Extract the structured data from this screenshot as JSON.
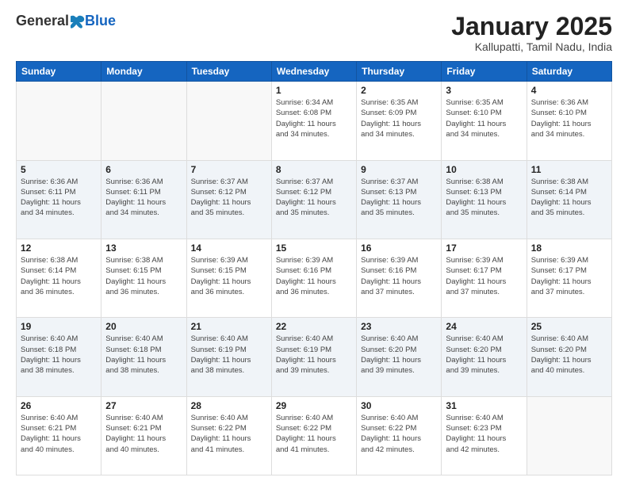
{
  "header": {
    "logo_general": "General",
    "logo_blue": "Blue",
    "month_title": "January 2025",
    "location": "Kallupatti, Tamil Nadu, India"
  },
  "days_of_week": [
    "Sunday",
    "Monday",
    "Tuesday",
    "Wednesday",
    "Thursday",
    "Friday",
    "Saturday"
  ],
  "weeks": [
    {
      "shaded": false,
      "days": [
        {
          "num": "",
          "info": ""
        },
        {
          "num": "",
          "info": ""
        },
        {
          "num": "",
          "info": ""
        },
        {
          "num": "1",
          "info": "Sunrise: 6:34 AM\nSunset: 6:08 PM\nDaylight: 11 hours\nand 34 minutes."
        },
        {
          "num": "2",
          "info": "Sunrise: 6:35 AM\nSunset: 6:09 PM\nDaylight: 11 hours\nand 34 minutes."
        },
        {
          "num": "3",
          "info": "Sunrise: 6:35 AM\nSunset: 6:10 PM\nDaylight: 11 hours\nand 34 minutes."
        },
        {
          "num": "4",
          "info": "Sunrise: 6:36 AM\nSunset: 6:10 PM\nDaylight: 11 hours\nand 34 minutes."
        }
      ]
    },
    {
      "shaded": true,
      "days": [
        {
          "num": "5",
          "info": "Sunrise: 6:36 AM\nSunset: 6:11 PM\nDaylight: 11 hours\nand 34 minutes."
        },
        {
          "num": "6",
          "info": "Sunrise: 6:36 AM\nSunset: 6:11 PM\nDaylight: 11 hours\nand 34 minutes."
        },
        {
          "num": "7",
          "info": "Sunrise: 6:37 AM\nSunset: 6:12 PM\nDaylight: 11 hours\nand 35 minutes."
        },
        {
          "num": "8",
          "info": "Sunrise: 6:37 AM\nSunset: 6:12 PM\nDaylight: 11 hours\nand 35 minutes."
        },
        {
          "num": "9",
          "info": "Sunrise: 6:37 AM\nSunset: 6:13 PM\nDaylight: 11 hours\nand 35 minutes."
        },
        {
          "num": "10",
          "info": "Sunrise: 6:38 AM\nSunset: 6:13 PM\nDaylight: 11 hours\nand 35 minutes."
        },
        {
          "num": "11",
          "info": "Sunrise: 6:38 AM\nSunset: 6:14 PM\nDaylight: 11 hours\nand 35 minutes."
        }
      ]
    },
    {
      "shaded": false,
      "days": [
        {
          "num": "12",
          "info": "Sunrise: 6:38 AM\nSunset: 6:14 PM\nDaylight: 11 hours\nand 36 minutes."
        },
        {
          "num": "13",
          "info": "Sunrise: 6:38 AM\nSunset: 6:15 PM\nDaylight: 11 hours\nand 36 minutes."
        },
        {
          "num": "14",
          "info": "Sunrise: 6:39 AM\nSunset: 6:15 PM\nDaylight: 11 hours\nand 36 minutes."
        },
        {
          "num": "15",
          "info": "Sunrise: 6:39 AM\nSunset: 6:16 PM\nDaylight: 11 hours\nand 36 minutes."
        },
        {
          "num": "16",
          "info": "Sunrise: 6:39 AM\nSunset: 6:16 PM\nDaylight: 11 hours\nand 37 minutes."
        },
        {
          "num": "17",
          "info": "Sunrise: 6:39 AM\nSunset: 6:17 PM\nDaylight: 11 hours\nand 37 minutes."
        },
        {
          "num": "18",
          "info": "Sunrise: 6:39 AM\nSunset: 6:17 PM\nDaylight: 11 hours\nand 37 minutes."
        }
      ]
    },
    {
      "shaded": true,
      "days": [
        {
          "num": "19",
          "info": "Sunrise: 6:40 AM\nSunset: 6:18 PM\nDaylight: 11 hours\nand 38 minutes."
        },
        {
          "num": "20",
          "info": "Sunrise: 6:40 AM\nSunset: 6:18 PM\nDaylight: 11 hours\nand 38 minutes."
        },
        {
          "num": "21",
          "info": "Sunrise: 6:40 AM\nSunset: 6:19 PM\nDaylight: 11 hours\nand 38 minutes."
        },
        {
          "num": "22",
          "info": "Sunrise: 6:40 AM\nSunset: 6:19 PM\nDaylight: 11 hours\nand 39 minutes."
        },
        {
          "num": "23",
          "info": "Sunrise: 6:40 AM\nSunset: 6:20 PM\nDaylight: 11 hours\nand 39 minutes."
        },
        {
          "num": "24",
          "info": "Sunrise: 6:40 AM\nSunset: 6:20 PM\nDaylight: 11 hours\nand 39 minutes."
        },
        {
          "num": "25",
          "info": "Sunrise: 6:40 AM\nSunset: 6:20 PM\nDaylight: 11 hours\nand 40 minutes."
        }
      ]
    },
    {
      "shaded": false,
      "days": [
        {
          "num": "26",
          "info": "Sunrise: 6:40 AM\nSunset: 6:21 PM\nDaylight: 11 hours\nand 40 minutes."
        },
        {
          "num": "27",
          "info": "Sunrise: 6:40 AM\nSunset: 6:21 PM\nDaylight: 11 hours\nand 40 minutes."
        },
        {
          "num": "28",
          "info": "Sunrise: 6:40 AM\nSunset: 6:22 PM\nDaylight: 11 hours\nand 41 minutes."
        },
        {
          "num": "29",
          "info": "Sunrise: 6:40 AM\nSunset: 6:22 PM\nDaylight: 11 hours\nand 41 minutes."
        },
        {
          "num": "30",
          "info": "Sunrise: 6:40 AM\nSunset: 6:22 PM\nDaylight: 11 hours\nand 42 minutes."
        },
        {
          "num": "31",
          "info": "Sunrise: 6:40 AM\nSunset: 6:23 PM\nDaylight: 11 hours\nand 42 minutes."
        },
        {
          "num": "",
          "info": ""
        }
      ]
    }
  ]
}
